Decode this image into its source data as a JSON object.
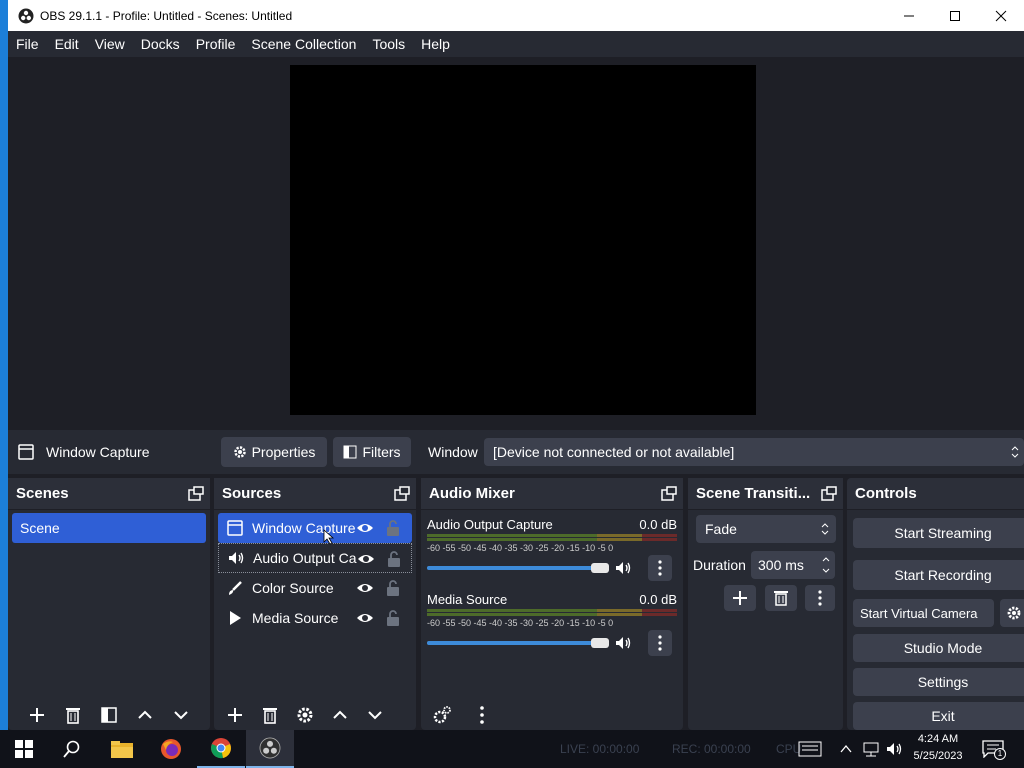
{
  "window": {
    "title": "OBS 29.1.1 - Profile: Untitled - Scenes: Untitled"
  },
  "menu": [
    "File",
    "Edit",
    "View",
    "Docks",
    "Profile",
    "Scene Collection",
    "Tools",
    "Help"
  ],
  "source_toolbar": {
    "selected_source": "Window Capture",
    "properties_label": "Properties",
    "filters_label": "Filters",
    "window_label": "Window",
    "window_value": "[Device not connected or not available]"
  },
  "scenes": {
    "title": "Scenes",
    "items": [
      "Scene"
    ]
  },
  "sources": {
    "title": "Sources",
    "items": [
      "Window Capture",
      "Audio Output Ca",
      "Color Source",
      "Media Source"
    ]
  },
  "audio_mixer": {
    "title": "Audio Mixer",
    "tick_labels": "-60 -55 -50 -45 -40 -35 -30 -25 -20 -15 -10  -5   0",
    "channels": [
      {
        "name": "Audio Output Capture",
        "db": "0.0 dB",
        "volume": 1.0
      },
      {
        "name": "Media Source",
        "db": "0.0 dB",
        "volume": 1.0
      }
    ]
  },
  "transitions": {
    "title": "Scene Transiti...",
    "transition": "Fade",
    "duration_label": "Duration",
    "duration_value": "300 ms"
  },
  "controls": {
    "title": "Controls",
    "start_streaming": "Start Streaming",
    "start_recording": "Start Recording",
    "start_virtual_camera": "Start Virtual Camera",
    "studio_mode": "Studio Mode",
    "settings": "Settings",
    "exit": "Exit"
  },
  "status": {
    "live": "LIVE: 00:00:00",
    "rec": "REC: 00:00:00",
    "cpu": "CPU"
  },
  "taskbar": {
    "time": "4:24 AM",
    "date": "5/25/2023",
    "notification_count": "1"
  },
  "colors": {
    "accent": "#2f5fd6",
    "dock_bg": "#272a33",
    "app_bg": "#1e1f26"
  }
}
